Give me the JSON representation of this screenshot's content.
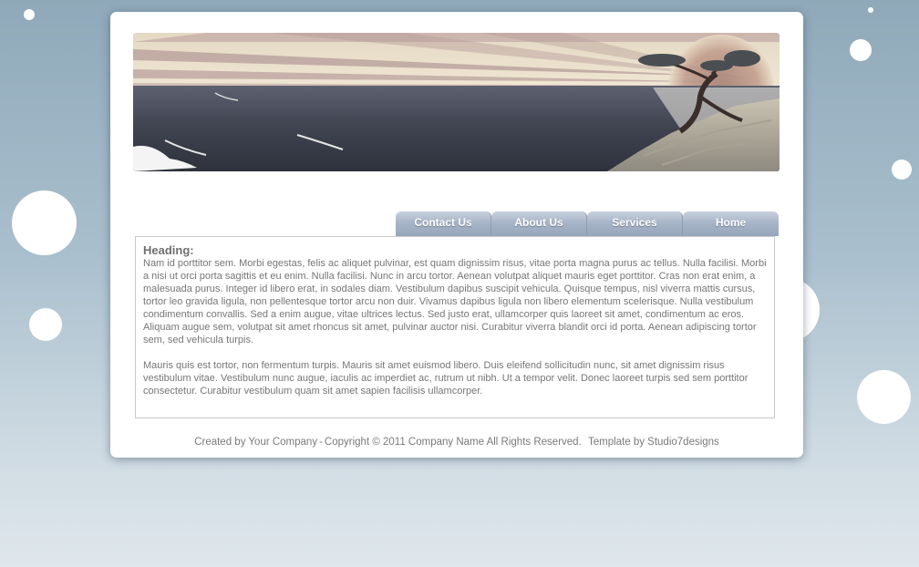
{
  "nav": {
    "items": [
      {
        "label": "Contact Us"
      },
      {
        "label": "About Us"
      },
      {
        "label": "Services"
      },
      {
        "label": "Home"
      }
    ]
  },
  "content": {
    "heading": "Heading:",
    "paragraph1": "Nam id porttitor sem. Morbi egestas, felis ac aliquet pulvinar, est quam dignissim risus, vitae porta magna purus ac tellus. Nulla facilisi. Morbi a nisi ut orci porta sagittis et eu enim. Nulla facilisi. Nunc in arcu tortor. Aenean volutpat aliquet mauris eget porttitor. Cras non erat enim, a malesuada purus. Integer id libero erat, in sodales diam. Vestibulum dapibus suscipit vehicula. Quisque tempus, nisl viverra mattis cursus, tortor leo gravida ligula, non pellentesque tortor arcu non duir. Vivamus dapibus ligula non libero elementum scelerisque. Nulla vestibulum condimentum convallis. Sed a enim augue, vitae ultrices lectus. Sed justo erat, ullamcorper quis laoreet sit amet, condimentum ac eros. Aliquam augue sem, volutpat sit amet rhoncus sit amet, pulvinar auctor nisi. Curabitur viverra blandit orci id porta. Aenean adipiscing tortor sem, sed vehicula turpis.",
    "paragraph2": "Mauris quis est tortor, non fermentum turpis. Mauris sit amet euismod libero. Duis eleifend sollicitudin nunc, sit amet dignissim risus vestibulum vitae. Vestibulum nunc augue, iaculis ac imperdiet ac, rutrum ut nibh. Ut a tempor velit. Donec laoreet turpis sed sem porttitor consectetur. Curabitur vestibulum quam sit amet sapien facilisis ullamcorper."
  },
  "footer": {
    "created_by": "Created by Your Company",
    "copyright": "Copyright © 2011 Company Name All Rights Reserved.",
    "template_by": "Template by Studio7designs"
  },
  "colors": {
    "page_background": "#a3b8c7",
    "tab": "#a8b5c8",
    "text": "#767676"
  }
}
